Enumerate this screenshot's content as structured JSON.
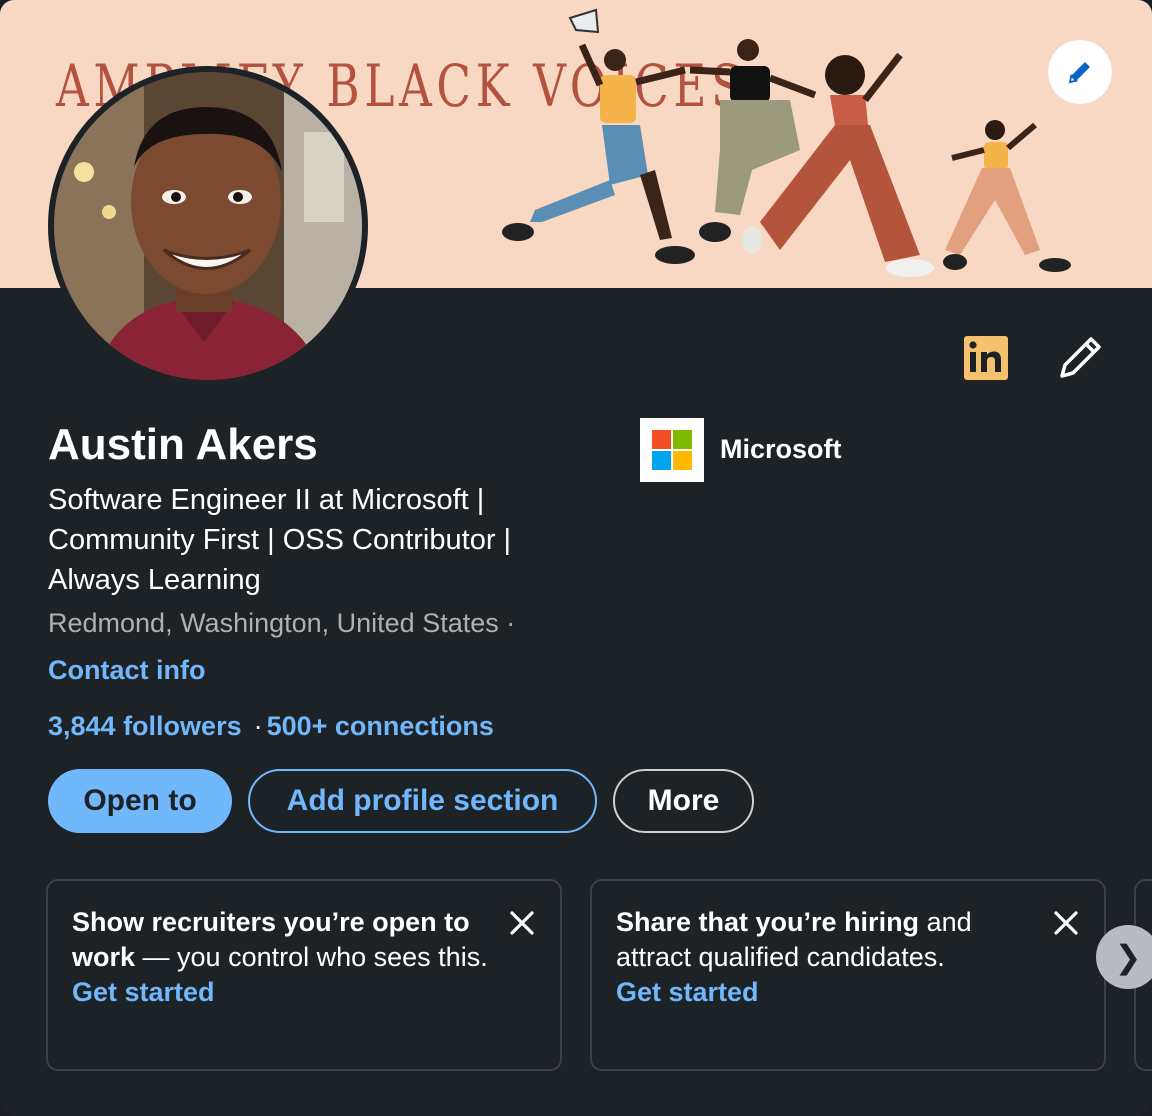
{
  "banner": {
    "title": "AMPLIFY BLACK VOICES",
    "background_color": "#f8d7c3"
  },
  "profile": {
    "name": "Austin Akers",
    "headline": "Software Engineer II at Microsoft | Community First | OSS Contributor | Always Learning",
    "location": "Redmond, Washington, United States ·",
    "contact_info_label": "Contact info",
    "followers": "3,844 followers",
    "connections_sep": "·",
    "connections": "500+ connections"
  },
  "company": {
    "name": "Microsoft",
    "logo_icon": "microsoft-logo-icon"
  },
  "actions": {
    "open_to": "Open to",
    "add_profile_section": "Add profile section",
    "more": "More"
  },
  "suggestions": [
    {
      "bold": "Show recruiters you’re open to work",
      "text": " — you control who sees this.",
      "link": "Get started"
    },
    {
      "bold": "Share that you’re hiring",
      "text": " and attract qualified candidates.",
      "link": "Get started"
    }
  ],
  "icons": {
    "edit_banner": "pencil-icon",
    "linkedin": "linkedin-icon",
    "edit_intro": "pencil-icon",
    "dismiss": "close-icon",
    "next": "chevron-right-icon"
  },
  "colors": {
    "accent": "#71b7fb",
    "background": "#1d2226",
    "linkedin_badge": "#f4c16f"
  }
}
